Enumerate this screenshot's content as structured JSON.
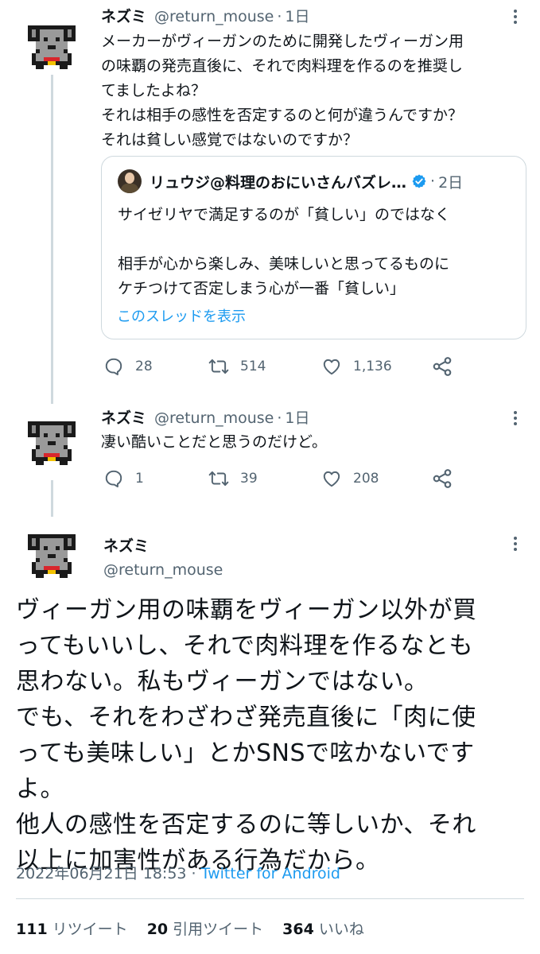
{
  "tweet1": {
    "name": "ネズミ",
    "handle": "@return_mouse",
    "dot": "·",
    "time": "1日",
    "text": "メーカーがヴィーガンのために開発したヴィーガン用\nの味覇の発売直後に、それで肉料理を作るのを推奨し\nてましたよね？\nそれは相手の感性を否定するのと何が違うんですか？\nそれは貧しい感覚ではないのですか？",
    "quote": {
      "name": "リュウジ@料理のおにいさんバズレ…",
      "dot": "·",
      "time": "2日",
      "text": "サイゼリヤで満足するのが「貧しい」のではなく\n\n相手が心から楽しみ、美味しいと思ってるものに\nケチつけて否定しまう心が一番「貧しい」",
      "thread_link": "このスレッドを表示"
    },
    "replies": "28",
    "retweets": "514",
    "likes": "1,136"
  },
  "tweet2": {
    "name": "ネズミ",
    "handle": "@return_mouse",
    "dot": "·",
    "time": "1日",
    "text": "凄い酷いことだと思うのだけど。",
    "replies": "1",
    "retweets": "39",
    "likes": "208"
  },
  "main": {
    "name": "ネズミ",
    "handle": "@return_mouse",
    "text": "ヴィーガン用の味覇をヴィーガン以外が買\nってもいいし、それで肉料理を作るなとも\n思わない。私もヴィーガンではない。\nでも、それをわざわざ発売直後に「肉に使\nっても美味しい」とかSNSで呟かないです\nよ。\n他人の感性を否定するのに等しいか、それ\n以上に加害性がある行為だから。",
    "datetime": "2022年06月21日 18:53",
    "sep": " · ",
    "source": "Twitter for Android",
    "stats": {
      "retweets_count": "111",
      "retweets_label": "リツイート",
      "quotes_count": "20",
      "quotes_label": "引用ツイート",
      "likes_count": "364",
      "likes_label": "いいね"
    }
  },
  "colors": {
    "accent": "#1d9bf0",
    "secondary_text": "#536471",
    "border": "#cfd9de"
  },
  "icons": [
    "mouse-avatar-icon",
    "more-icon",
    "reply-icon",
    "retweet-icon",
    "like-icon",
    "share-icon",
    "verified-icon"
  ]
}
